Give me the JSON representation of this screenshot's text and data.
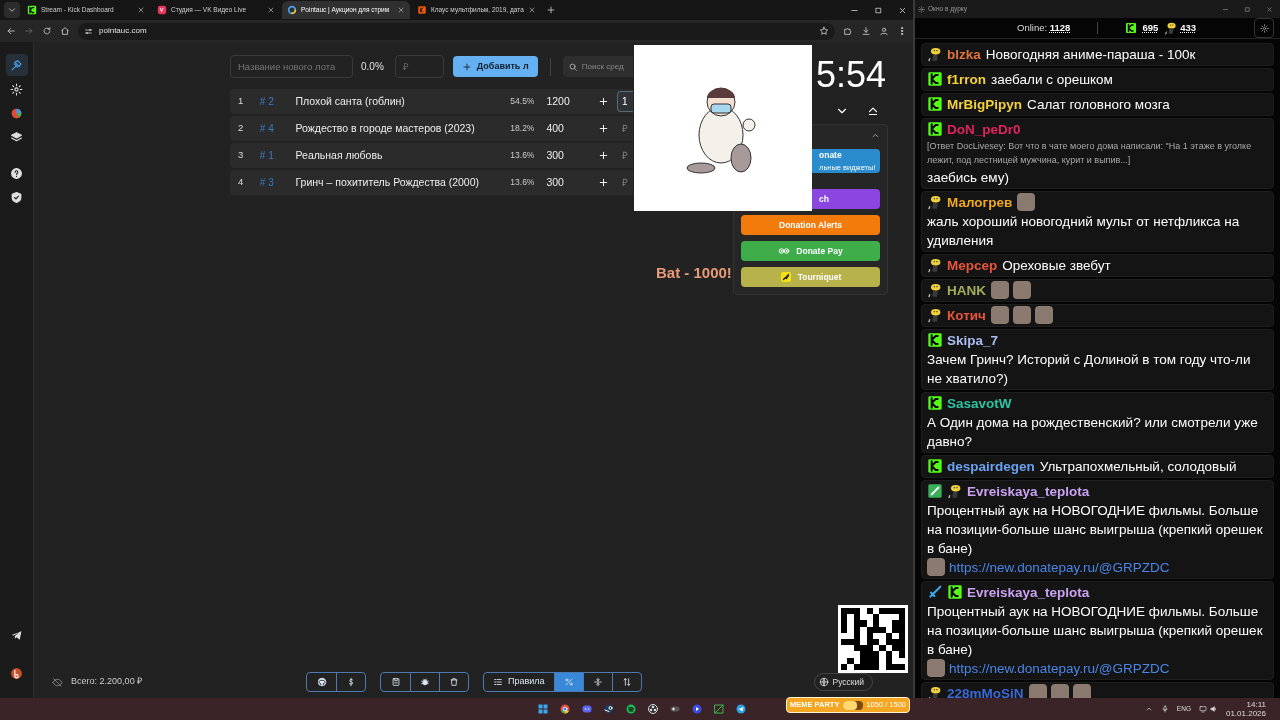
{
  "browser": {
    "tabs": [
      {
        "title": "Stream - Kick Dashboard",
        "kind": "kick",
        "selected": false
      },
      {
        "title": "Студия — VK Видео Live",
        "kind": "vk",
        "selected": false
      },
      {
        "title": "Pointauc | Аукцион для стрим",
        "kind": "pointauc",
        "selected": true
      },
      {
        "title": "Клаус мультфильм, 2019, дата",
        "kind": "kinopoisk",
        "selected": false
      }
    ],
    "address": "pointauc.com"
  },
  "sidebar": {
    "items": [
      {
        "kind": "gavel",
        "selected": true
      },
      {
        "kind": "gear",
        "selected": false
      },
      {
        "kind": "pie",
        "selected": false
      },
      {
        "kind": "layers",
        "selected": false
      },
      {
        "kind": "help",
        "selected": false
      },
      {
        "kind": "shield",
        "selected": false
      }
    ],
    "bottom": [
      {
        "kind": "telegram"
      },
      {
        "kind": "logo"
      }
    ]
  },
  "lot_form": {
    "name_placeholder": "Название нового лота",
    "percent": "0.0%",
    "amount_placeholder": "₽",
    "add_button": "Добавить л",
    "search_placeholder": "Поиск сред"
  },
  "lots": [
    {
      "rank": "1",
      "id": "# 2",
      "name": "Плохой санта (гоблин)",
      "percent": "54.5%",
      "amount": "1200",
      "input_value": "1"
    },
    {
      "rank": "2",
      "id": "# 4",
      "name": "Рождество в городе мастеров (2023)",
      "percent": "18.2%",
      "amount": "400",
      "input_placeholder": "₽"
    },
    {
      "rank": "3",
      "id": "# 1",
      "name": "Реальная любовь",
      "percent": "13.6%",
      "amount": "300",
      "input_placeholder": "₽"
    },
    {
      "rank": "4",
      "id": "# 3",
      "name": "Гринч – похититель Рождества (2000)",
      "percent": "13.6%",
      "amount": "300",
      "input_placeholder": "₽"
    }
  ],
  "timer": "5:54",
  "alert_text": "Bat - 1000!",
  "donate_buttons": [
    {
      "label": "onate",
      "sublabel": "льные виджеты!",
      "color": "#2a8ccc"
    },
    {
      "label": "ch",
      "color": "#8b45e0"
    },
    {
      "label": "Donation Alerts",
      "color": "#f37b0c"
    },
    {
      "label": "Donate Pay",
      "color": "#3fae4a",
      "kind": "donatepay"
    },
    {
      "label": "Tourniquet",
      "color": "#b8b24a",
      "kind": "tourniquet"
    }
  ],
  "bottom_bar": {
    "total": "Всего: 2.200,00 ₽",
    "groups": [
      [
        {
          "kind": "github"
        },
        {
          "kind": "dollar"
        }
      ],
      [
        {
          "kind": "save"
        },
        {
          "kind": "bug"
        },
        {
          "kind": "trash"
        }
      ],
      [
        {
          "kind": "list",
          "label": "Правила",
          "selected": false
        },
        {
          "kind": "percent",
          "selected": true
        },
        {
          "kind": "split",
          "selected": false
        },
        {
          "kind": "sort",
          "selected": false
        }
      ]
    ],
    "language": "Русский"
  },
  "chat": {
    "window_title": "Окно в дурку",
    "online_label": "Online:",
    "online": "1128",
    "kick_count": "695",
    "vk_count": "433",
    "messages": [
      {
        "badges": [
          {
            "kind": "avatar"
          }
        ],
        "user": "blzka",
        "color": "#e0743a",
        "parts": [
          {
            "kind": "text",
            "text": "Новогодняя аниме-параша - 100к"
          }
        ]
      },
      {
        "badges": [
          {
            "kind": "kick"
          }
        ],
        "user": "f1rron",
        "color": "#f2d23c",
        "parts": [
          {
            "kind": "text",
            "text": "заебали с орешком"
          }
        ]
      },
      {
        "badges": [
          {
            "kind": "kick"
          }
        ],
        "user": "MrBigPipyn",
        "color": "#f2d23c",
        "parts": [
          {
            "kind": "text",
            "text": "Салат головного мозга"
          }
        ]
      },
      {
        "badges": [
          {
            "kind": "kick"
          }
        ],
        "user": "DoN_peDr0",
        "color": "#e0245e",
        "parts": [
          {
            "kind": "reply",
            "text": "[Ответ DocLivesey: Вот что в чате моего дома написали: \"На 1 этаже в уголке лежит, под лестницей мужчина, курит и выпив...]"
          },
          {
            "kind": "text",
            "text": "заебись ему)"
          }
        ]
      },
      {
        "badges": [
          {
            "kind": "avatar"
          }
        ],
        "user": "Малогрев",
        "color": "#f0a81e",
        "parts": [
          {
            "kind": "emote"
          },
          {
            "kind": "text",
            "text": "жаль хороший новогодний мульт от нетфликса на удивления"
          }
        ]
      },
      {
        "badges": [
          {
            "kind": "avatar"
          }
        ],
        "user": "Мерсер",
        "color": "#e8553a",
        "parts": [
          {
            "kind": "text",
            "text": "Ореховые звебут"
          }
        ]
      },
      {
        "badges": [
          {
            "kind": "avatar"
          }
        ],
        "user": "HANK",
        "color": "#a4ad5c",
        "parts": [
          {
            "kind": "emote"
          },
          {
            "kind": "emote"
          }
        ]
      },
      {
        "badges": [
          {
            "kind": "avatar"
          }
        ],
        "user": "Котич",
        "color": "#e8553a",
        "parts": [
          {
            "kind": "emote"
          },
          {
            "kind": "emote"
          },
          {
            "kind": "emote"
          }
        ]
      },
      {
        "badges": [
          {
            "kind": "kick"
          }
        ],
        "user": "Skipa_7",
        "color": "#a9bff2",
        "parts": [
          {
            "kind": "text",
            "text": "Зачем Гринч? Историй с Долиной в том году что-ли не хватило?)"
          }
        ]
      },
      {
        "badges": [
          {
            "kind": "kick"
          }
        ],
        "user": "SasavotW",
        "color": "#2ec4a2",
        "parts": [
          {
            "kind": "text",
            "text": "А Один дома на рождественский? или смотрели уже давно?"
          }
        ]
      },
      {
        "badges": [
          {
            "kind": "kick"
          }
        ],
        "user": "despairdegen",
        "color": "#6ba2f0",
        "parts": [
          {
            "kind": "text",
            "text": "Ультрапохмельный, солодовый"
          }
        ]
      },
      {
        "badges": [
          {
            "kind": "pencil"
          },
          {
            "kind": "avatar"
          }
        ],
        "user": "Evreiskaya_teplota",
        "color": "#c9a2f2",
        "parts": [
          {
            "kind": "text",
            "text": "Процентный аук на НОВОГОДНИЕ фильмы. Больше на позиции-больше шанс выигрыша (крепкий орешек в бане)"
          },
          {
            "kind": "emote"
          },
          {
            "kind": "link",
            "text": "https://new.donatepay.ru/@GRPZDC"
          }
        ]
      },
      {
        "badges": [
          {
            "kind": "sword"
          },
          {
            "kind": "kick"
          }
        ],
        "user": "Evreiskaya_teplota",
        "color": "#c9a2f2",
        "parts": [
          {
            "kind": "text",
            "text": "Процентный аук на НОВОГОДНИЕ фильмы. Больше на позиции-больше шанс выигрыша (крепкий орешек в бане)"
          },
          {
            "kind": "emote"
          },
          {
            "kind": "link",
            "text": "https://new.donatepay.ru/@GRPZDC"
          }
        ]
      },
      {
        "badges": [
          {
            "kind": "avatar"
          }
        ],
        "user": "228mMoSiN",
        "color": "#3a6ad4",
        "parts": [
          {
            "kind": "emote"
          },
          {
            "kind": "emote"
          },
          {
            "kind": "emote"
          }
        ]
      }
    ]
  },
  "taskbar": {
    "meme_party": {
      "label": "MEME PARTY",
      "reading": "1050 / 1500",
      "level": 0.7
    },
    "language": "ENG",
    "time": "14:11",
    "date": "01.01.2026"
  }
}
